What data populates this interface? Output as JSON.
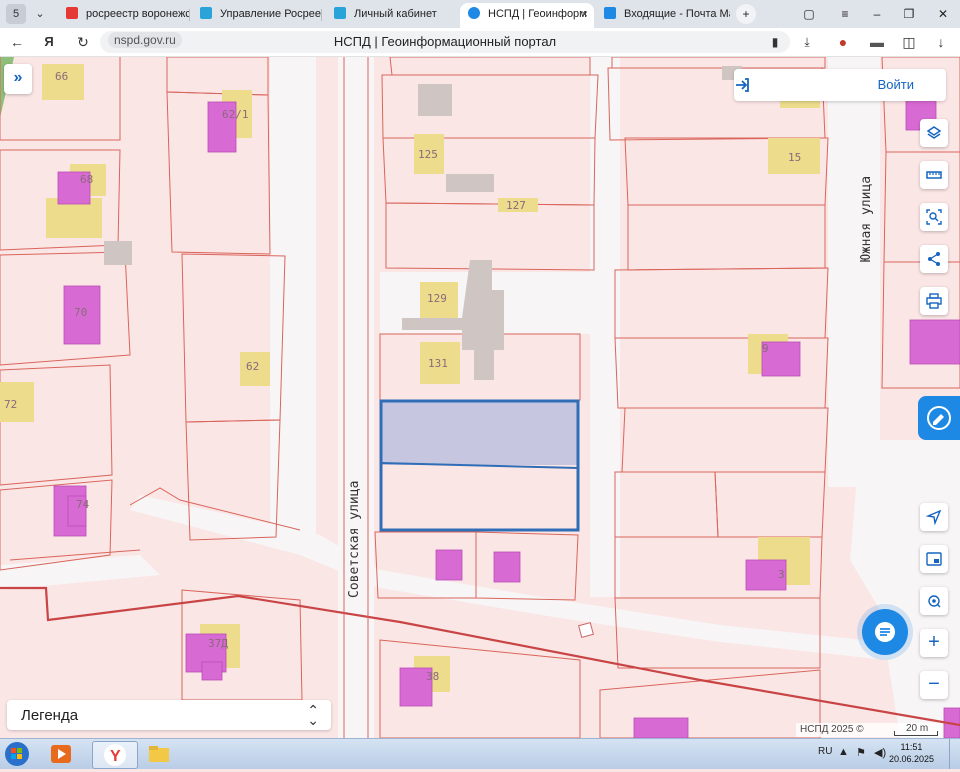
{
  "browser": {
    "tab_counter": "5",
    "tabs": [
      {
        "title": "росреестр воронежск",
        "fav_color": "#e53935"
      },
      {
        "title": "Управление Росреест",
        "fav_color": "#2aa3d8"
      },
      {
        "title": "Личный кабинет",
        "fav_color": "#2aa3d8"
      },
      {
        "title": "НСПД | Геоинформ",
        "fav_color": "#1e88e5"
      },
      {
        "title": "Входящие - Почта Ma",
        "fav_color": "#1e88e5"
      }
    ],
    "active_tab": 3,
    "url_domain": "nspd.gov.ru",
    "page_title": "НСПД | Геоинформационный портал"
  },
  "map": {
    "login_label": "Войти",
    "legend_label": "Легенда",
    "attribution": "НСПД 2025 ©",
    "scale_label": "20 m",
    "street_labels": {
      "sovetskaya": "Советская улица",
      "yuzhnaya": "Южная улица"
    },
    "parcel_numbers": {
      "n66": "66",
      "n62_1": "62/1",
      "n68": "68",
      "n70": "70",
      "n62": "62",
      "n72": "72",
      "n74": "74",
      "n37d": "37Д",
      "n125": "125",
      "n127": "127",
      "n129": "129",
      "n131": "131",
      "n38": "38",
      "n15": "15",
      "n9": "9",
      "n3": "3"
    },
    "colors": {
      "background": "#fbe6e6",
      "parcel_border": "#d9655b",
      "building_yellow": "#ecdc8c",
      "building_magenta": "#d86ad4",
      "building_gray": "#cfc6c3",
      "selected_parcel": "#2f6db6",
      "boundary_line": "#c94545",
      "accent": "#1e88e5"
    }
  },
  "taskbar": {
    "language": "RU",
    "time": "11:51",
    "date": "20.06.2025"
  }
}
